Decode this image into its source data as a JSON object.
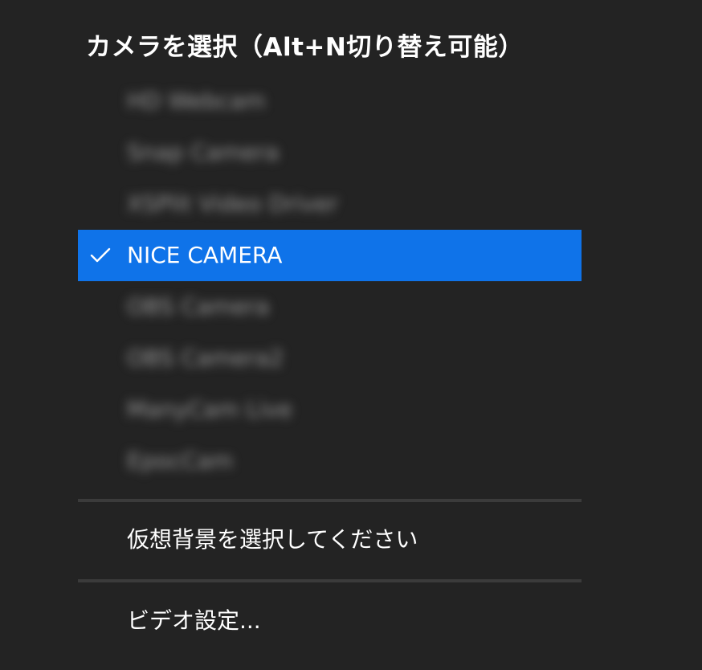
{
  "menu": {
    "title": "カメラを選択（Alt+N切り替え可能）",
    "cameras": [
      {
        "label": "HD Webcam",
        "selected": false,
        "blurred": true
      },
      {
        "label": "Snap Camera",
        "selected": false,
        "blurred": true
      },
      {
        "label": "XSPlit Video Driver",
        "selected": false,
        "blurred": true
      },
      {
        "label": "NICE CAMERA",
        "selected": true,
        "blurred": false
      },
      {
        "label": "OBS Camera",
        "selected": false,
        "blurred": true
      },
      {
        "label": "OBS Camera2",
        "selected": false,
        "blurred": true
      },
      {
        "label": "ManyCam Live",
        "selected": false,
        "blurred": true
      },
      {
        "label": "EpocCam",
        "selected": false,
        "blurred": true
      }
    ],
    "virtual_background_label": "仮想背景を選択してください",
    "video_settings_label": "ビデオ設定..."
  },
  "colors": {
    "background": "#232323",
    "selected": "#0f73e9",
    "divider": "#3b3b3b",
    "text": "#ffffff"
  },
  "icons": {
    "selected_indicator": "checkmark-icon"
  }
}
